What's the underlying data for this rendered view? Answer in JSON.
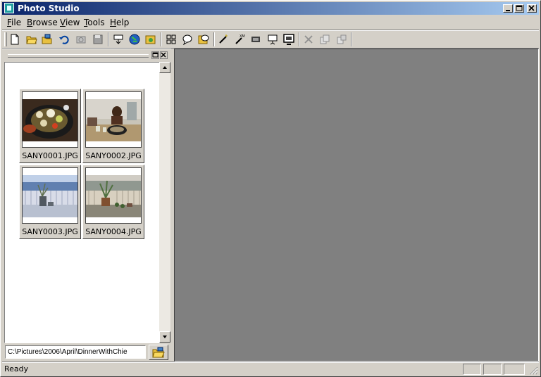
{
  "window": {
    "title": "Photo Studio"
  },
  "menu": [
    {
      "label_ul": "F",
      "label_rest": "ile"
    },
    {
      "label_ul": "B",
      "label_rest": "rowse"
    },
    {
      "label_ul": "V",
      "label_rest": "iew"
    },
    {
      "label_ul": "T",
      "label_rest": "ools"
    },
    {
      "label_ul": "H",
      "label_rest": "elp"
    }
  ],
  "toolbar": {
    "icons": [
      "new-document-icon",
      "open-folder-icon",
      "browse-folder-icon",
      "undo-icon",
      "capture-icon",
      "save-icon",
      "download-icon",
      "web-icon",
      "slideshow-folder-icon",
      "thumbnail-grid-icon",
      "comment-icon",
      "info-icon",
      "magic-wand-icon",
      "xml-wand-icon",
      "film-icon",
      "presentation-icon",
      "monitor-icon",
      "delete-icon",
      "copy-icon",
      "move-icon"
    ]
  },
  "thumbnails": [
    {
      "filename": "SANY0001.JPG",
      "scene": "food",
      "selected": false
    },
    {
      "filename": "SANY0002.JPG",
      "scene": "dinner",
      "selected": false
    },
    {
      "filename": "SANY0003.JPG",
      "scene": "balcony-blue",
      "selected": false
    },
    {
      "filename": "SANY0004.JPG",
      "scene": "balcony-plants",
      "selected": false
    }
  ],
  "path": {
    "value": "C:\\Pictures\\2006\\April\\DinnerWithChie"
  },
  "status": {
    "text": "Ready"
  },
  "colors": {
    "title_start": "#0a246a",
    "title_end": "#a6caf0",
    "viewer_bg": "#808080",
    "face": "#d4d0c8"
  }
}
